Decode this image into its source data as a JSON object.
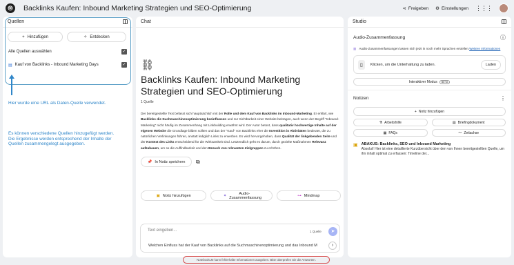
{
  "app": {
    "title": "Backlinks Kaufen: Inbound Marketing Strategien und SEO-Optimierung",
    "share": "Freigeben",
    "settings": "Einstellungen"
  },
  "sources": {
    "header": "Quellen",
    "add": "Hinzufügen",
    "discover": "Entdecken",
    "select_all": "Alle Quellen auswählen",
    "item": "Kauf von Backlinks - Inbound Marketing Days"
  },
  "annotations": {
    "note1": "Hier wurde eine URL als Daten-Quelle verwendet.",
    "note2": "Es können verschiedene Quellen hinzugefügt werden. Die Ergebnisse werden entsprechend der Inhalte der Quellen zusammengelegt ausgegeben."
  },
  "chat": {
    "header": "Chat",
    "doc_title": "Backlinks Kaufen: Inbound Marketing Strategien und SEO-Optimierung",
    "source_count": "1 Quelle",
    "p_pre": "Der bereitgestellte Text befasst sich hauptsächlich mit der ",
    "b1": "Rolle und dem Kauf von Backlinks im Inbound-Marketing",
    "p1": ". Er erklärt, wie ",
    "b2": "Backlinks die Suchmaschinenoptimierung beeinflussen",
    "p2": " und zur Sichtbarkeit einer Website beitragen, auch wenn der Begriff \"Inbound-Marketing\" nicht häufig im Zusammenhang mit Linkbuilding erwähnt wird. Der Autor betont, dass ",
    "b3": "qualitativ hochwertige Inhalte auf der eigenen Website",
    "p3": " die Grundlage bilden sollten und das der \"Kauf\" von Backlinks eher die ",
    "b4": "Investition in Aktivitäten",
    "p4": " bedeutet, die zu natürlichen Verlinkungen führen, anstatt lediglich Links zu erwerben. Es wird hervorgehoben, dass ",
    "b5": "Qualität der linkgebenden Seite",
    "p5": " und der ",
    "b6": "Kontext des Links",
    "p6": " entscheidend für die Wirksamkeit sind. Letztendlich geht es darum, durch gezielte Maßnahmen ",
    "b7": "Relevanz aufzubauen",
    "p7": ", um so die Auffindbarkeit und den ",
    "b8": "Besuch von relevanten Zielgruppen",
    "p8": " zu erhöhen.",
    "save_note": "In Notiz speichern",
    "add_note": "Notiz hinzufügen",
    "audio_summary": "Audio-Zusammenfassung",
    "mindmap": "Mindmap",
    "input_placeholder": "Text eingeben...",
    "input_sources": "1 Quelle",
    "suggestion": "Welchen Einfluss hat der Kauf von Backlinks auf die Suchmaschinenoptimierung und das Inbound M",
    "footer": "NotebookLM kann fehlerhafte Informationen ausgeben. Bitte überprüfen Sie die Antworten."
  },
  "studio": {
    "header": "Studio",
    "audio_header": "Audio-Zusammenfassung",
    "info_text": "Audio-Zusammenfassungen lassen sich jetzt in noch mehr Sprachen erstellen.",
    "info_link": "Weitere Informationen",
    "click_text": "Klicken, um die Unterhaltung zu laden.",
    "load": "Laden",
    "interactive": "Interaktiver Modus",
    "beta": "BETA",
    "notes_header": "Notizen",
    "add_note": "Notiz hinzufügen",
    "work": "Arbeitshilfe",
    "briefing": "Briefingdokument",
    "faq": "FAQs",
    "timeline": "Zeitachse",
    "note_title": "ABAKUS: Backlinks, SEO und Inbound Marketing",
    "note_text": "Absolut! Hier ist eine detaillierte Kurzübersicht über den von Ihnen bereitgestellten Quelle, um ihn inhalt optimal zu erfassen: Timeline der..."
  },
  "colors": {
    "accent": "#2f86c9",
    "annotation_box": "#5b9fc7",
    "footer_border": "#d65050",
    "send": "#a7b5f5"
  }
}
